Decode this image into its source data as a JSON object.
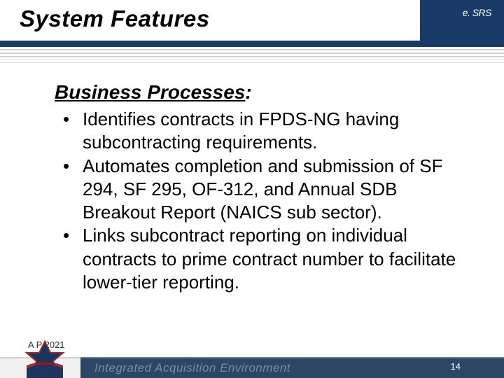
{
  "header": {
    "title": "System Features",
    "brand": "e. SRS"
  },
  "content": {
    "section_title": "Business Processes",
    "section_title_suffix": ":",
    "bullets": [
      "Identifies contracts in FPDS-NG having subcontracting requirements.",
      "Automates completion and submission of SF 294, SF 295, OF-312, and Annual SDB Breakout Report (NAICS sub sector).",
      "Links subcontract reporting on individual contracts to prime contract number to facilitate lower-tier reporting."
    ]
  },
  "footer": {
    "date": "A P 2021",
    "page_number": "14",
    "brand": "Integrated Acquisition Environment"
  },
  "colors": {
    "primary": "#193a66",
    "footer_bar": "#2c4666"
  }
}
